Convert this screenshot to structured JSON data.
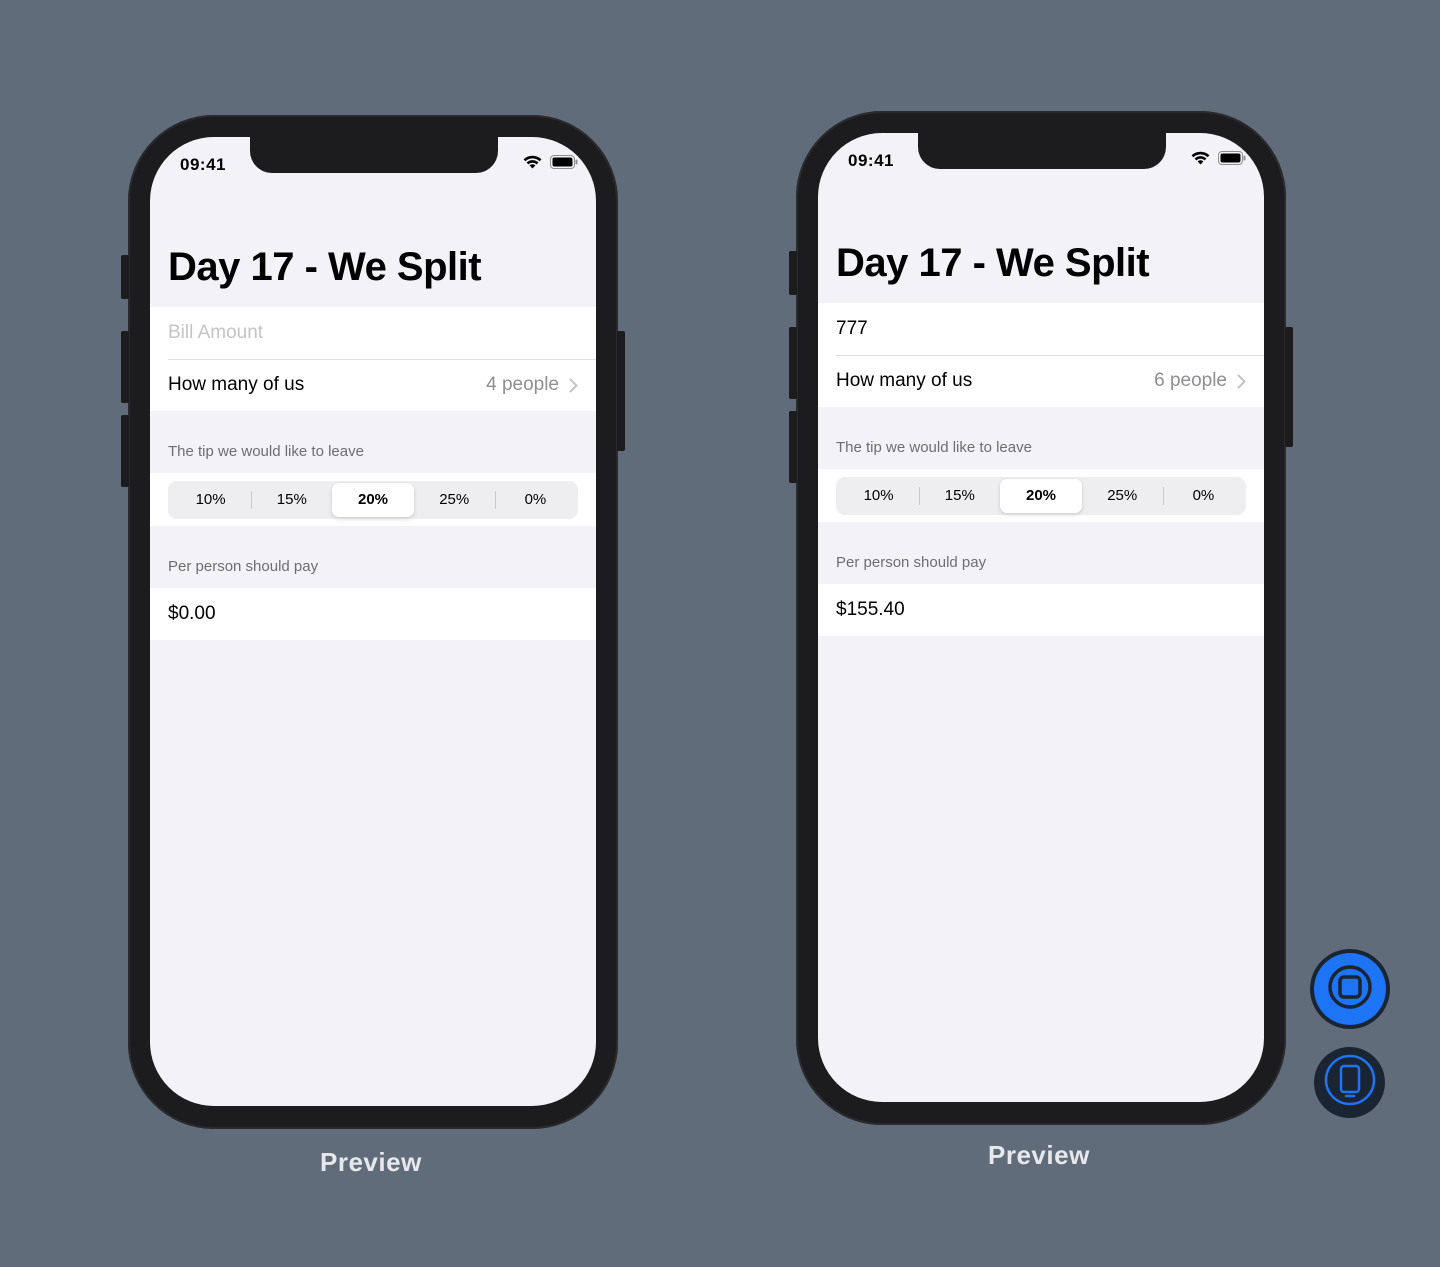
{
  "colors": {
    "background": "#616c7a",
    "device_frame": "#1c1c1e",
    "screen_background": "#f2f2f7",
    "accent_blue": "#1d74f5",
    "secondary_text": "#8e8e93"
  },
  "previews": [
    {
      "status_time": "09:41",
      "title": "Day 17 - We Split",
      "bill_amount_value": "",
      "bill_amount_placeholder": "Bill Amount",
      "people_label": "How many of us",
      "people_value": "4 people",
      "tip_header": "The tip we would like to leave",
      "tip_options": [
        "10%",
        "15%",
        "20%",
        "25%",
        "0%"
      ],
      "selected_tip": "20%",
      "pay_header": "Per person should pay",
      "per_person_amount": "$0.00",
      "caption": "Preview"
    },
    {
      "status_time": "09:41",
      "title": "Day 17 - We Split",
      "bill_amount_value": "777",
      "bill_amount_placeholder": "Bill Amount",
      "people_label": "How many of us",
      "people_value": "6 people",
      "tip_header": "The tip we would like to leave",
      "tip_options": [
        "10%",
        "15%",
        "20%",
        "25%",
        "0%"
      ],
      "selected_tip": "20%",
      "pay_header": "Per person should pay",
      "per_person_amount": "$155.40",
      "caption": "Preview"
    }
  ],
  "controls": {
    "live_preview_icon": "live-preview-icon",
    "device_settings_icon": "device-settings-icon"
  }
}
